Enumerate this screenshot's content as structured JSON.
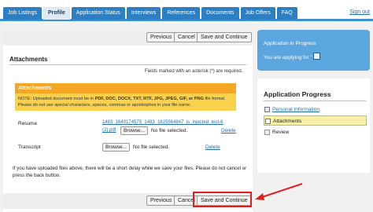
{
  "nav": {
    "tabs": [
      "Job Listings",
      "Profile",
      "Application Status",
      "Interviews",
      "References",
      "Documents",
      "Job Offers",
      "FAQ"
    ],
    "active_tab": "Profile",
    "signout_label": "Sign out"
  },
  "buttons": {
    "previous": "Previous",
    "cancel": "Cancel",
    "save_continue": "Save and Continue"
  },
  "attachments": {
    "title": "Attachments",
    "required_note_prefix": "Fields marked with an asterisk (",
    "required_note_ast": "*",
    "required_note_suffix": ") are required.",
    "box_title": "Attachments",
    "box_note_1": "NOTE: Uploaded document must be in ",
    "box_note_formats": "PDF, DOC, DOCX, TXT, RTF, JPG, JPEG, GIF, or PNG",
    "box_note_2": " file format. Please do not use special characters, spaces, commas or apostrophes in your file name.",
    "resume_label": "Resume",
    "resume_file_line1": "1483_1640174575_1483_1625564847_js_injected_test-6",
    "resume_file_line2": "(2).pdf",
    "browse_label": "Browse...",
    "no_file": "No file selected.",
    "delete_label": "Delete",
    "transcript_label": "Transcript",
    "delay_note": "If you have uploaded files above, there will be a short delay while we save your files. Please do not cancel or press the back button."
  },
  "sidebar": {
    "progress_title": "Application in Progress",
    "applying_for": "You are applying for \"",
    "ap_title": "Application Progress",
    "items": [
      {
        "label": "Personal Information",
        "state": "link"
      },
      {
        "label": "Attachments",
        "state": "current"
      },
      {
        "label": "Review",
        "state": "pending"
      }
    ]
  },
  "colors": {
    "tab_blue": "#2c7fc2",
    "panel_blue": "#5ba6de",
    "header_orange": "#f5a623",
    "note_yellow": "#f9d14c",
    "highlight_red": "#e02020"
  }
}
